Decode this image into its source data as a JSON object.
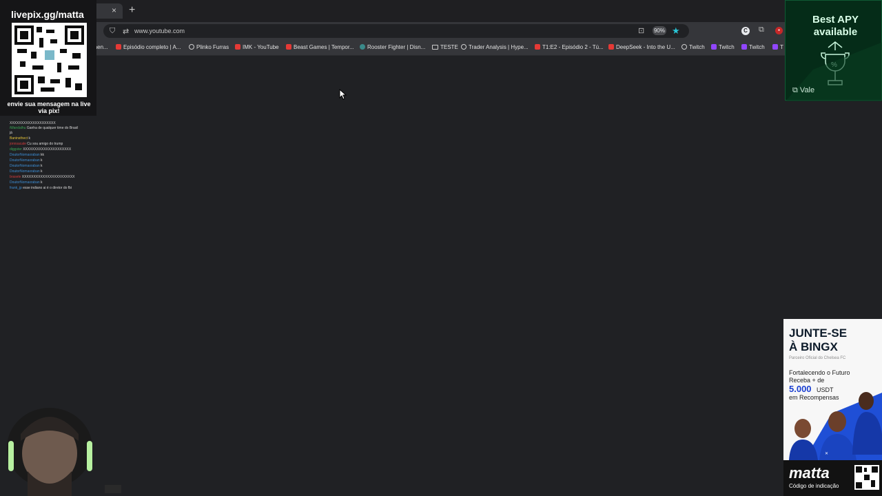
{
  "browser": {
    "tab_close": "×",
    "new_tab": "+",
    "url": "www.youtube.com",
    "zoom": "90%",
    "profile_letter": "C",
    "bookmarks": [
      {
        "label": "amen...",
        "icon": "none"
      },
      {
        "label": "Episódio completo | A...",
        "icon": "youtube-icon"
      },
      {
        "label": "Plinko Furras",
        "icon": "globe-icon"
      },
      {
        "label": "IMK - YouTube",
        "icon": "youtube-icon"
      },
      {
        "label": "Beast Games | Tempor...",
        "icon": "youtube-icon"
      },
      {
        "label": "Rooster Fighter | Disn...",
        "icon": "rooster-icon"
      },
      {
        "label": "TESTE",
        "icon": "folder-icon"
      },
      {
        "label": "Trader Analysis | Hype...",
        "icon": "globe-icon"
      },
      {
        "label": "T1:E2 - Episódio 2 - Tú...",
        "icon": "youtube-icon"
      },
      {
        "label": "DeepSeek - Into the U...",
        "icon": "youtube-icon"
      },
      {
        "label": "Twitch",
        "icon": "globe-icon"
      },
      {
        "label": "Twitch",
        "icon": "twitch-icon"
      },
      {
        "label": "Twitch",
        "icon": "twitch-icon"
      },
      {
        "label": "T",
        "icon": "twitch-icon"
      }
    ]
  },
  "overlay": {
    "livepix_title": "livepix.gg/matta",
    "qr_caption": "envie sua mensagem na live via pix!",
    "chat": [
      {
        "user": "iWandalhu",
        "user_color": "g",
        "text": "Ganha de qualquer time do Brasil já"
      },
      {
        "user": "Baninsthect",
        "user_color": "y",
        "text": "k"
      },
      {
        "user": "jonnsacale",
        "user_color": "r",
        "text": "Cu sou amigo do trump"
      },
      {
        "user": "diggster",
        "user_color": "g",
        "text": "XXXXXXXXXXXXXXXXXXXXX"
      },
      {
        "user": "DoutorNomaxraban",
        "user_color": "p",
        "text": "kk"
      },
      {
        "user": "DoutorNomaxraban",
        "user_color": "p",
        "text": "k"
      },
      {
        "user": "DoutorNomaxraban",
        "user_color": "p",
        "text": "k"
      },
      {
        "user": "DoutorNomaxraban",
        "user_color": "p",
        "text": "k"
      },
      {
        "user": "brasele",
        "user_color": "r",
        "text": "XXXXXXXXXXXXXXXXXXXXXXX"
      },
      {
        "user": "DoutorNomaxraban",
        "user_color": "p",
        "text": "k"
      },
      {
        "user": "frank_jp",
        "user_color": "p",
        "text": "esse indiano ai é o diretor do fbi"
      }
    ],
    "chat_top_dots": "XXXXXXXXXXXXXXXXXXXX"
  },
  "ads": {
    "apy_title": "Best APY available",
    "apy_brand": "Vale",
    "bingx_headline_1": "JUNTE-SE",
    "bingx_headline_2": "À BINGX",
    "bingx_sub": "Parceiro Oficial do Chelsea FC",
    "bingx_line1": "Fortalecendo o Futuro",
    "bingx_line2": "Receba + de",
    "bingx_amount": "5.000",
    "bingx_currency": "USDT",
    "bingx_line3": "em Recompensas",
    "matta_logo": "matta",
    "matta_code": "Código de indicação"
  },
  "colors": {
    "page_bg": "#202124",
    "toolbar": "#35363a",
    "star": "#29c5d6",
    "apy_bg": "#052c18",
    "bingx_blue": "#1a3fd1"
  }
}
